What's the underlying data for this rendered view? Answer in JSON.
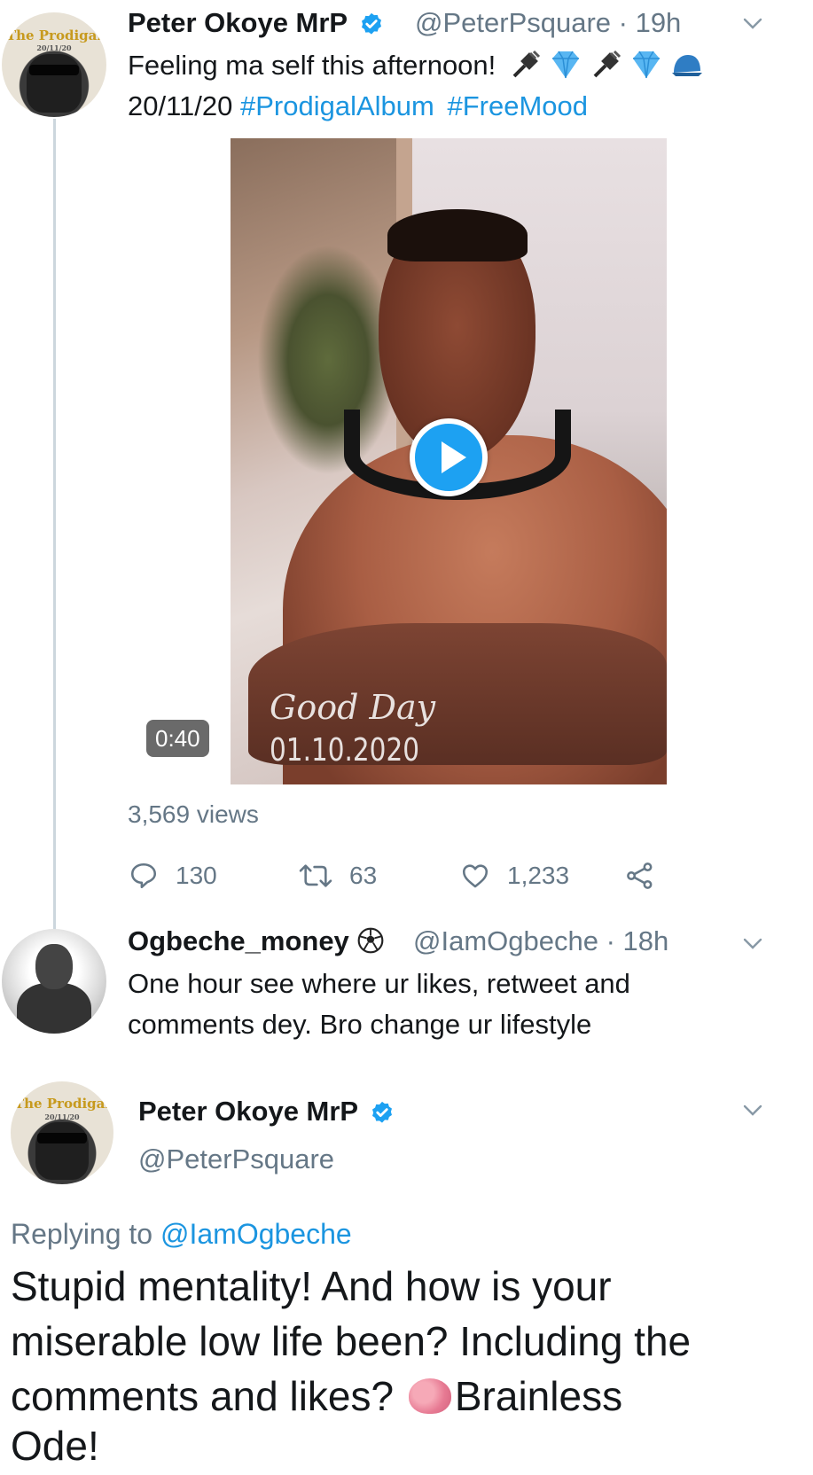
{
  "tweet1": {
    "avatar_text": "The Prodigal",
    "avatar_date": "20/11/20",
    "name": "Peter Okoye MrP",
    "handle": "@PeterPsquare · 19h",
    "line1": "Feeling ma self this afternoon!",
    "line1_emojis": [
      "plug-icon",
      "diamond-icon",
      "plug-icon",
      "diamond-icon",
      "cap-icon"
    ],
    "line2_date": "20/11/20",
    "hashtag1": "#ProdigalAlbum",
    "hashtag2": "#FreeMood",
    "video": {
      "overlay_line1": "Good Day",
      "overlay_line2": "01.10.2020",
      "duration": "0:40"
    },
    "views": "3,569 views",
    "actions": {
      "replies": "130",
      "retweets": "63",
      "likes": "1,233"
    }
  },
  "tweet2": {
    "name": "Ogbeche_money",
    "handle": "@IamOgbeche · 18h",
    "line1": "One hour see where ur likes, retweet and",
    "line2": "comments dey. Bro change ur lifestyle"
  },
  "tweet3": {
    "avatar_text": "The Prodigal",
    "avatar_date": "20/11/20",
    "name": "Peter Okoye MrP",
    "handle": "@PeterPsquare",
    "replying_prefix": "Replying to",
    "replying_mention": "@IamOgbeche",
    "line1": "Stupid mentality! And how is your",
    "line2": "miserable low life been? Including the",
    "line3a": "comments and likes?",
    "line3b": "Brainless",
    "line4": "Ode!"
  },
  "colors": {
    "link": "#1b95e0",
    "verified": "#1da1f2",
    "secondary_text": "#657786",
    "thread_line": "#ccd6dd"
  }
}
